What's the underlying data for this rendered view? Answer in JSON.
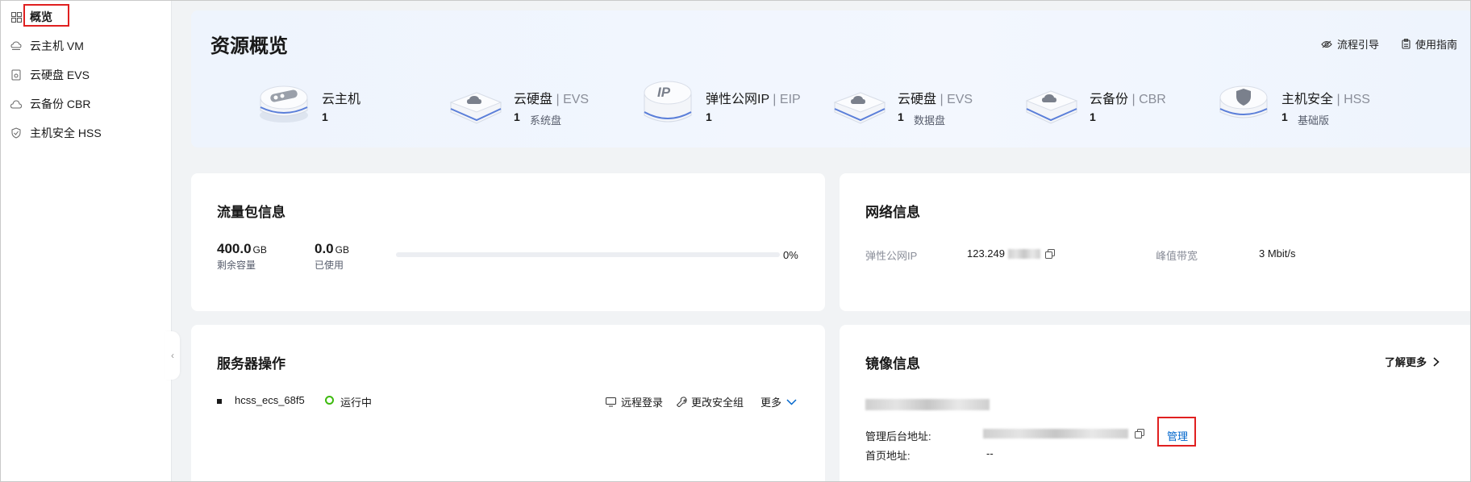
{
  "sidebar": {
    "items": [
      {
        "label": "概览",
        "icon": "grid-icon",
        "active": true
      },
      {
        "label": "云主机 VM",
        "icon": "cloud-server-icon"
      },
      {
        "label": "云硬盘 EVS",
        "icon": "disk-icon"
      },
      {
        "label": "云备份 CBR",
        "icon": "cloud-icon"
      },
      {
        "label": "主机安全 HSS",
        "icon": "shield-icon"
      }
    ],
    "collapse": "‹"
  },
  "overview": {
    "title": "资源概览",
    "links": [
      {
        "label": "流程引导",
        "icon": "eye-icon"
      },
      {
        "label": "使用指南",
        "icon": "clipboard-icon"
      }
    ],
    "resources": [
      {
        "name": "云主机",
        "suffix": "",
        "count": "1",
        "sub": "",
        "icon": "server-device-icon"
      },
      {
        "name": "云硬盘",
        "suffix": " | EVS",
        "count": "1",
        "sub": "系统盘",
        "icon": "disk-device-icon"
      },
      {
        "name": "弹性公网IP",
        "suffix": " | EIP",
        "count": "1",
        "sub": "",
        "icon": "ip-device-icon"
      },
      {
        "name": "云硬盘",
        "suffix": " | EVS",
        "count": "1",
        "sub": "数据盘",
        "icon": "disk-device-icon"
      },
      {
        "name": "云备份",
        "suffix": " | CBR",
        "count": "1",
        "sub": "",
        "icon": "backup-device-icon"
      },
      {
        "name": "主机安全",
        "suffix": " | HSS",
        "count": "1",
        "sub": "基础版",
        "icon": "security-device-icon"
      }
    ]
  },
  "traffic": {
    "title": "流量包信息",
    "remaining_value": "400.0",
    "remaining_unit": "GB",
    "remaining_label": "剩余容量",
    "used_value": "0.0",
    "used_unit": "GB",
    "used_label": "已使用",
    "percent": "0%",
    "progress_fraction": 0
  },
  "network": {
    "title": "网络信息",
    "eip_label": "弹性公网IP",
    "eip_value": "123.249",
    "bandwidth_label": "峰值带宽",
    "bandwidth_value": "3 Mbit/s"
  },
  "server_ops": {
    "title": "服务器操作",
    "server_name": "hcss_ecs_68f5",
    "status": "运行中",
    "actions": [
      "远程登录",
      "更改安全组",
      "更多"
    ]
  },
  "image_info": {
    "title": "镜像信息",
    "learn_more": "了解更多",
    "admin_label": "管理后台地址:",
    "manage": "管理",
    "home_label": "首页地址:",
    "home_value": "--"
  },
  "colors": {
    "accent": "#0066cc",
    "running": "#3dba0e",
    "highlight": "#e02020"
  }
}
